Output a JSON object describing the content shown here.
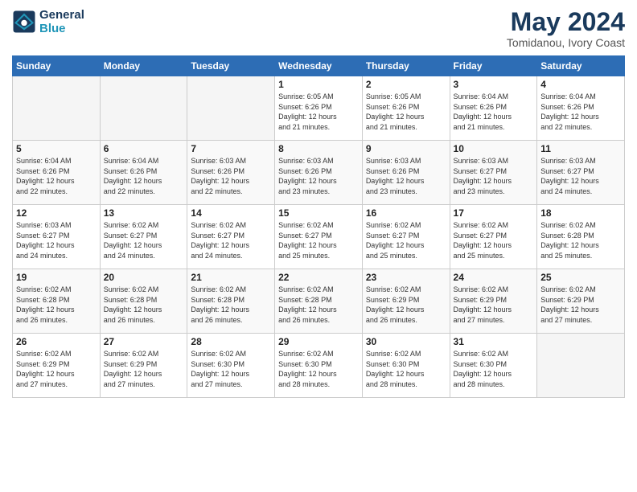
{
  "header": {
    "logo_line1": "General",
    "logo_line2": "Blue",
    "month_year": "May 2024",
    "location": "Tomidanou, Ivory Coast"
  },
  "weekdays": [
    "Sunday",
    "Monday",
    "Tuesday",
    "Wednesday",
    "Thursday",
    "Friday",
    "Saturday"
  ],
  "weeks": [
    [
      {
        "day": "",
        "info": ""
      },
      {
        "day": "",
        "info": ""
      },
      {
        "day": "",
        "info": ""
      },
      {
        "day": "1",
        "info": "Sunrise: 6:05 AM\nSunset: 6:26 PM\nDaylight: 12 hours\nand 21 minutes."
      },
      {
        "day": "2",
        "info": "Sunrise: 6:05 AM\nSunset: 6:26 PM\nDaylight: 12 hours\nand 21 minutes."
      },
      {
        "day": "3",
        "info": "Sunrise: 6:04 AM\nSunset: 6:26 PM\nDaylight: 12 hours\nand 21 minutes."
      },
      {
        "day": "4",
        "info": "Sunrise: 6:04 AM\nSunset: 6:26 PM\nDaylight: 12 hours\nand 22 minutes."
      }
    ],
    [
      {
        "day": "5",
        "info": "Sunrise: 6:04 AM\nSunset: 6:26 PM\nDaylight: 12 hours\nand 22 minutes."
      },
      {
        "day": "6",
        "info": "Sunrise: 6:04 AM\nSunset: 6:26 PM\nDaylight: 12 hours\nand 22 minutes."
      },
      {
        "day": "7",
        "info": "Sunrise: 6:03 AM\nSunset: 6:26 PM\nDaylight: 12 hours\nand 22 minutes."
      },
      {
        "day": "8",
        "info": "Sunrise: 6:03 AM\nSunset: 6:26 PM\nDaylight: 12 hours\nand 23 minutes."
      },
      {
        "day": "9",
        "info": "Sunrise: 6:03 AM\nSunset: 6:26 PM\nDaylight: 12 hours\nand 23 minutes."
      },
      {
        "day": "10",
        "info": "Sunrise: 6:03 AM\nSunset: 6:27 PM\nDaylight: 12 hours\nand 23 minutes."
      },
      {
        "day": "11",
        "info": "Sunrise: 6:03 AM\nSunset: 6:27 PM\nDaylight: 12 hours\nand 24 minutes."
      }
    ],
    [
      {
        "day": "12",
        "info": "Sunrise: 6:03 AM\nSunset: 6:27 PM\nDaylight: 12 hours\nand 24 minutes."
      },
      {
        "day": "13",
        "info": "Sunrise: 6:02 AM\nSunset: 6:27 PM\nDaylight: 12 hours\nand 24 minutes."
      },
      {
        "day": "14",
        "info": "Sunrise: 6:02 AM\nSunset: 6:27 PM\nDaylight: 12 hours\nand 24 minutes."
      },
      {
        "day": "15",
        "info": "Sunrise: 6:02 AM\nSunset: 6:27 PM\nDaylight: 12 hours\nand 25 minutes."
      },
      {
        "day": "16",
        "info": "Sunrise: 6:02 AM\nSunset: 6:27 PM\nDaylight: 12 hours\nand 25 minutes."
      },
      {
        "day": "17",
        "info": "Sunrise: 6:02 AM\nSunset: 6:27 PM\nDaylight: 12 hours\nand 25 minutes."
      },
      {
        "day": "18",
        "info": "Sunrise: 6:02 AM\nSunset: 6:28 PM\nDaylight: 12 hours\nand 25 minutes."
      }
    ],
    [
      {
        "day": "19",
        "info": "Sunrise: 6:02 AM\nSunset: 6:28 PM\nDaylight: 12 hours\nand 26 minutes."
      },
      {
        "day": "20",
        "info": "Sunrise: 6:02 AM\nSunset: 6:28 PM\nDaylight: 12 hours\nand 26 minutes."
      },
      {
        "day": "21",
        "info": "Sunrise: 6:02 AM\nSunset: 6:28 PM\nDaylight: 12 hours\nand 26 minutes."
      },
      {
        "day": "22",
        "info": "Sunrise: 6:02 AM\nSunset: 6:28 PM\nDaylight: 12 hours\nand 26 minutes."
      },
      {
        "day": "23",
        "info": "Sunrise: 6:02 AM\nSunset: 6:29 PM\nDaylight: 12 hours\nand 26 minutes."
      },
      {
        "day": "24",
        "info": "Sunrise: 6:02 AM\nSunset: 6:29 PM\nDaylight: 12 hours\nand 27 minutes."
      },
      {
        "day": "25",
        "info": "Sunrise: 6:02 AM\nSunset: 6:29 PM\nDaylight: 12 hours\nand 27 minutes."
      }
    ],
    [
      {
        "day": "26",
        "info": "Sunrise: 6:02 AM\nSunset: 6:29 PM\nDaylight: 12 hours\nand 27 minutes."
      },
      {
        "day": "27",
        "info": "Sunrise: 6:02 AM\nSunset: 6:29 PM\nDaylight: 12 hours\nand 27 minutes."
      },
      {
        "day": "28",
        "info": "Sunrise: 6:02 AM\nSunset: 6:30 PM\nDaylight: 12 hours\nand 27 minutes."
      },
      {
        "day": "29",
        "info": "Sunrise: 6:02 AM\nSunset: 6:30 PM\nDaylight: 12 hours\nand 28 minutes."
      },
      {
        "day": "30",
        "info": "Sunrise: 6:02 AM\nSunset: 6:30 PM\nDaylight: 12 hours\nand 28 minutes."
      },
      {
        "day": "31",
        "info": "Sunrise: 6:02 AM\nSunset: 6:30 PM\nDaylight: 12 hours\nand 28 minutes."
      },
      {
        "day": "",
        "info": ""
      }
    ]
  ]
}
